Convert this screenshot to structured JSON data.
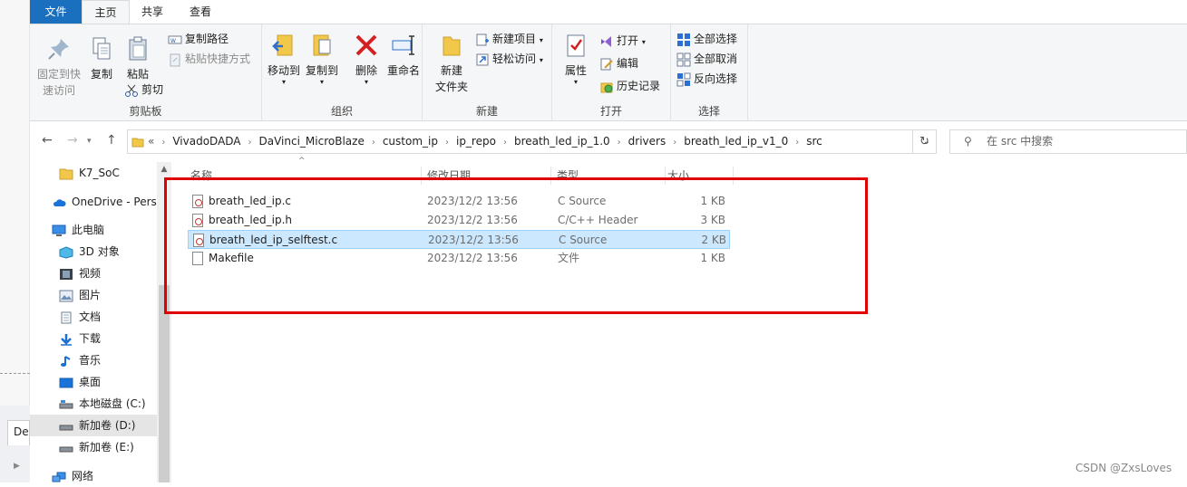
{
  "tabs": {
    "file": "文件",
    "home": "主页",
    "share": "共享",
    "view": "查看"
  },
  "ribbon": {
    "clipboard": {
      "pin_line1": "固定到快",
      "pin_line2": "速访问",
      "copy": "复制",
      "paste": "粘贴",
      "copy_path": "复制路径",
      "paste_shortcut": "粘贴快捷方式",
      "cut": "剪切",
      "label": "剪贴板"
    },
    "organize": {
      "move_to": "移动到",
      "copy_to": "复制到",
      "delete": "删除",
      "rename": "重命名",
      "label": "组织"
    },
    "new": {
      "new_folder_line1": "新建",
      "new_folder_line2": "文件夹",
      "new_item": "新建项目",
      "easy_access": "轻松访问",
      "label": "新建"
    },
    "open": {
      "properties": "属性",
      "open": "打开",
      "edit": "编辑",
      "history": "历史记录",
      "label": "打开"
    },
    "select": {
      "select_all": "全部选择",
      "select_none": "全部取消",
      "invert": "反向选择",
      "label": "选择"
    }
  },
  "address": {
    "overflow": "«",
    "crumbs": [
      "VivadoDADA",
      "DaVinci_MicroBlaze",
      "custom_ip",
      "ip_repo",
      "breath_led_ip_1.0",
      "drivers",
      "breath_led_ip_v1_0",
      "src"
    ],
    "search_placeholder": "在 src 中搜索"
  },
  "nav": {
    "items": [
      {
        "label": "K7_SoC",
        "icon": "folder-icon"
      },
      {
        "label": "OneDrive - Perso",
        "icon": "cloud-icon"
      },
      {
        "label": "此电脑",
        "icon": "computer-icon"
      },
      {
        "label": "3D 对象",
        "icon": "cube-icon"
      },
      {
        "label": "视频",
        "icon": "video-icon"
      },
      {
        "label": "图片",
        "icon": "picture-icon"
      },
      {
        "label": "文档",
        "icon": "document-icon"
      },
      {
        "label": "下载",
        "icon": "download-icon"
      },
      {
        "label": "音乐",
        "icon": "music-icon"
      },
      {
        "label": "桌面",
        "icon": "desktop-icon"
      },
      {
        "label": "本地磁盘 (C:)",
        "icon": "drive-icon"
      },
      {
        "label": "新加卷 (D:)",
        "icon": "drive-icon"
      },
      {
        "label": "新加卷 (E:)",
        "icon": "drive-icon"
      },
      {
        "label": "网络",
        "icon": "network-icon"
      }
    ]
  },
  "columns": {
    "name": "名称",
    "date": "修改日期",
    "type": "类型",
    "size": "大小"
  },
  "files": [
    {
      "name": "breath_led_ip.c",
      "date": "2023/12/2 13:56",
      "type": "C Source",
      "size": "1 KB"
    },
    {
      "name": "breath_led_ip.h",
      "date": "2023/12/2 13:56",
      "type": "C/C++ Header",
      "size": "3 KB"
    },
    {
      "name": "breath_led_ip_selftest.c",
      "date": "2023/12/2 13:56",
      "type": "C Source",
      "size": "2 KB"
    },
    {
      "name": "Makefile",
      "date": "2023/12/2 13:56",
      "type": "文件",
      "size": "1 KB"
    }
  ],
  "background_window": {
    "tab_label": "Des"
  },
  "watermark": "CSDN @ZxsLoves",
  "colors": {
    "accent": "#1a6fbf",
    "selection": "#cce8ff",
    "highlight_box": "#e00000"
  }
}
